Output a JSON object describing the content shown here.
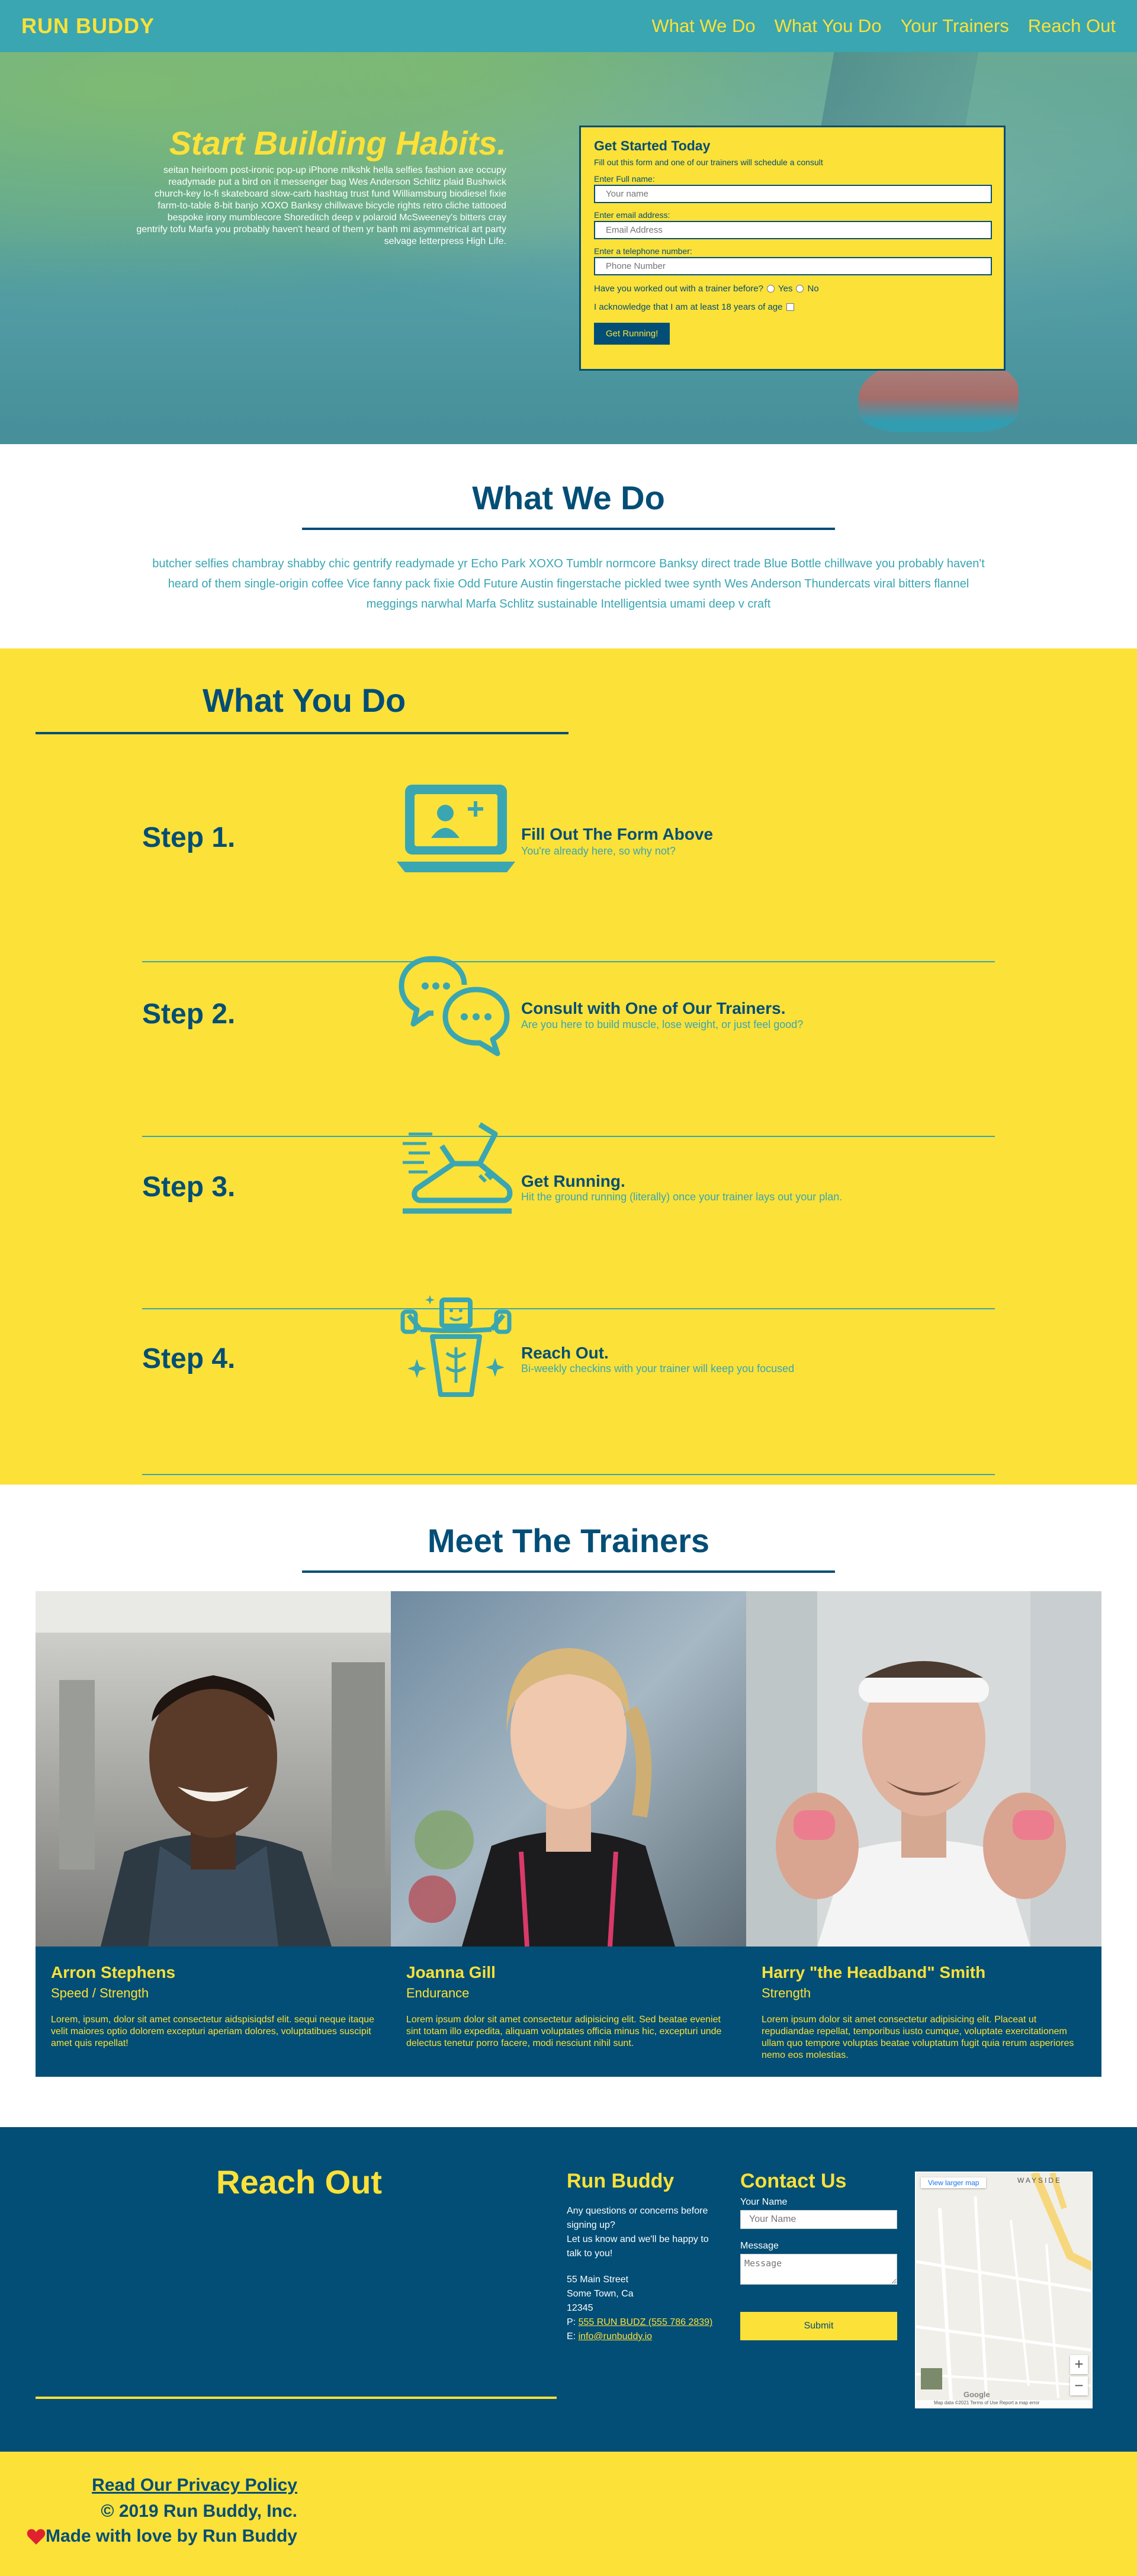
{
  "header": {
    "logo": "RUN BUDDY",
    "nav": [
      "What We Do",
      "What You Do",
      "Your Trainers",
      "Reach Out"
    ]
  },
  "hero": {
    "title": "Start Building Habits.",
    "body": "seitan heirloom post-ironic pop-up iPhone mlkshk hella selfies fashion axe occupy readymade put a bird on it messenger bag Wes Anderson Schlitz plaid Bushwick church-key lo-fi skateboard slow-carb hashtag trust fund Williamsburg biodiesel fixie farm-to-table 8-bit banjo XOXO Banksy chillwave bicycle rights retro cliche tattooed bespoke irony mumblecore Shoreditch deep v polaroid McSweeney's bitters cray gentrify tofu Marfa you probably haven't heard of them yr banh mi asymmetrical art party selvage letterpress High Life."
  },
  "form": {
    "title": "Get Started Today",
    "subtitle": "Fill out this form and one of our trainers will schedule a consult",
    "name_label": "Enter Full name:",
    "name_placeholder": "Your name",
    "email_label": "Enter email address:",
    "email_placeholder": "Email Address",
    "phone_label": "Enter a telephone number:",
    "phone_placeholder": "Phone Number",
    "worked_out_question": "Have you worked out with a trainer before?",
    "yes": "Yes",
    "no": "No",
    "age_ack": "I acknowledge that I am at least 18 years of age",
    "submit": "Get Running!"
  },
  "what_we_do": {
    "title": "What We Do",
    "body": "butcher selfies chambray shabby chic gentrify readymade yr Echo Park XOXO Tumblr normcore Banksy direct trade Blue Bottle chillwave you probably haven't heard of them single-origin coffee Vice fanny pack fixie Odd Future Austin fingerstache pickled twee synth Wes Anderson Thundercats viral bitters flannel meggings narwhal Marfa Schlitz sustainable Intelligentsia umami deep v craft"
  },
  "what_you_do": {
    "title": "What You Do",
    "steps": [
      {
        "label": "Step 1.",
        "heading": "Fill Out The Form Above",
        "sub": "You're already here, so why not?",
        "icon": "laptop-user-icon"
      },
      {
        "label": "Step 2.",
        "heading": "Consult with One of Our Trainers.",
        "sub": "Are you here to build muscle, lose weight, or just feel good?",
        "icon": "chat-bubbles-icon"
      },
      {
        "label": "Step 3.",
        "heading": "Get Running.",
        "sub": "Hit the ground running (literally) once your trainer lays out your plan.",
        "icon": "running-shoe-icon"
      },
      {
        "label": "Step 4.",
        "heading": "Reach Out.",
        "sub": "Bi-weekly checkins with your trainer will keep you focused",
        "icon": "strong-person-icon"
      }
    ]
  },
  "trainers": {
    "title": "Meet The Trainers",
    "list": [
      {
        "name": "Arron Stephens",
        "role": "Speed / Strength",
        "bio": "Lorem, ipsum, dolor sit amet consectetur aidspisiqdsf elit. sequi neque itaque velit maiores optio dolorem excepturi aperiam dolores, voluptatibues suscipit amet quis repellat!"
      },
      {
        "name": "Joanna Gill",
        "role": "Endurance",
        "bio": "Lorem ipsum dolor sit amet consectetur adipisicing elit. Sed beatae eveniet sint totam illo expedita, aliquam voluptates officia minus hic, excepturi unde delectus tenetur porro facere, modi nesciunt nihil sunt."
      },
      {
        "name": "Harry \"the Headband\" Smith",
        "role": "Strength",
        "bio": "Lorem ipsum dolor sit amet consectetur adipisicing elit. Placeat ut repudiandae repellat, temporibus iusto cumque, voluptate exercitationem ullam quo tempore voluptas beatae voluptatum fugit quia rerum asperiores nemo eos molestias."
      }
    ]
  },
  "reach_out": {
    "title": "Reach Out",
    "company": "Run Buddy",
    "intro_1": "Any questions or concerns before signing up?",
    "intro_2": "Let us know and we'll be happy to talk to you!",
    "street": "55 Main Street",
    "city": "Some Town, Ca",
    "zip": "12345",
    "phone_prefix": "P:",
    "phone": "555 RUN BUDZ (555 786 2839)",
    "email_prefix": "E:",
    "email": "info@runbuddy.io",
    "contact_title": "Contact Us",
    "name_label": "Your Name",
    "name_placeholder": "Your Name",
    "message_label": "Message",
    "message_placeholder": "Message",
    "submit": "Submit",
    "map": {
      "link": "View larger map",
      "area_label": "WAYSIDE",
      "zoom_in": "+",
      "zoom_out": "−",
      "brand": "Google",
      "attribution": "Map data ©2021   Terms of Use   Report a map error"
    }
  },
  "footer": {
    "privacy": "Read Our Privacy Policy",
    "copyright": "© 2019 Run Buddy, Inc.",
    "made_with": "Made with love by Run Buddy"
  },
  "colors": {
    "primary_dark": "#024e76",
    "accent_yellow": "#fce138",
    "teal": "#39a6b2"
  }
}
